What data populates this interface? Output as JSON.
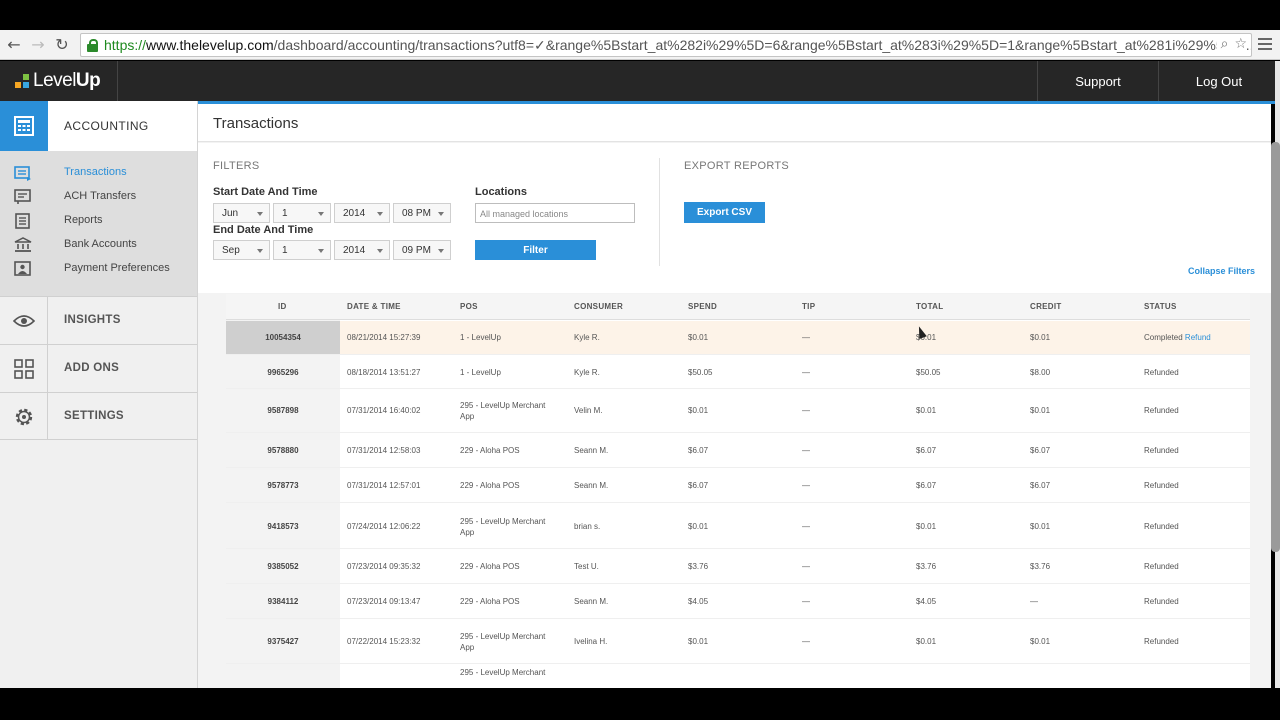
{
  "browser": {
    "url_scheme": "https://",
    "url_host": "www.thelevelup.com",
    "url_path": "/dashboard/accounting/transactions?utf8=✓&range%5Bstart_at%282i%29%5D=6&range%5Bstart_at%283i%29%5D=1&range%5Bstart_at%281i%29%5D=..."
  },
  "header": {
    "logo_level": "Level",
    "logo_up": "Up",
    "support": "Support",
    "logout": "Log Out"
  },
  "sidebar": {
    "accounting": "ACCOUNTING",
    "sub_items": [
      {
        "label": "Transactions",
        "icon": "transactions-icon",
        "active": true
      },
      {
        "label": "ACH Transfers",
        "icon": "ach-transfers-icon",
        "active": false
      },
      {
        "label": "Reports",
        "icon": "reports-icon",
        "active": false
      },
      {
        "label": "Bank Accounts",
        "icon": "bank-icon",
        "active": false
      },
      {
        "label": "Payment Preferences",
        "icon": "payment-preferences-icon",
        "active": false
      }
    ],
    "sections": [
      {
        "label": "INSIGHTS",
        "icon": "eye-icon"
      },
      {
        "label": "ADD ONS",
        "icon": "grid-icon"
      },
      {
        "label": "SETTINGS",
        "icon": "gear-icon"
      }
    ]
  },
  "page": {
    "title": "Transactions"
  },
  "filters": {
    "title": "FILTERS",
    "start_label": "Start Date And Time",
    "end_label": "End Date And Time",
    "start": {
      "month": "Jun",
      "day": "1",
      "year": "2014",
      "time": "08 PM"
    },
    "end": {
      "month": "Sep",
      "day": "1",
      "year": "2014",
      "time": "09 PM"
    },
    "locations_label": "Locations",
    "locations_placeholder": "All managed locations",
    "filter_button": "Filter",
    "export_title": "EXPORT REPORTS",
    "export_button": "Export CSV",
    "collapse": "Collapse Filters"
  },
  "table": {
    "headers": [
      "ID",
      "DATE & TIME",
      "POS",
      "CONSUMER",
      "SPEND",
      "TIP",
      "TOTAL",
      "CREDIT",
      "STATUS"
    ],
    "rows": [
      {
        "id": "10054354",
        "datetime": "08/21/2014 15:27:39",
        "pos": "1 - LevelUp",
        "consumer": "Kyle R.",
        "spend": "$0.01",
        "tip": "—",
        "total": "$0.01",
        "credit": "$0.01",
        "status": "Completed",
        "refund": "Refund"
      },
      {
        "id": "9965296",
        "datetime": "08/18/2014 13:51:27",
        "pos": "1 - LevelUp",
        "consumer": "Kyle R.",
        "spend": "$50.05",
        "tip": "—",
        "total": "$50.05",
        "credit": "$8.00",
        "status": "Refunded"
      },
      {
        "id": "9587898",
        "datetime": "07/31/2014 16:40:02",
        "pos": "295 - LevelUp Merchant App",
        "consumer": "Velin M.",
        "spend": "$0.01",
        "tip": "—",
        "total": "$0.01",
        "credit": "$0.01",
        "status": "Refunded"
      },
      {
        "id": "9578880",
        "datetime": "07/31/2014 12:58:03",
        "pos": "229 - Aloha POS",
        "consumer": "Seann M.",
        "spend": "$6.07",
        "tip": "—",
        "total": "$6.07",
        "credit": "$6.07",
        "status": "Refunded"
      },
      {
        "id": "9578773",
        "datetime": "07/31/2014 12:57:01",
        "pos": "229 - Aloha POS",
        "consumer": "Seann M.",
        "spend": "$6.07",
        "tip": "—",
        "total": "$6.07",
        "credit": "$6.07",
        "status": "Refunded"
      },
      {
        "id": "9418573",
        "datetime": "07/24/2014 12:06:22",
        "pos": "295 - LevelUp Merchant App",
        "consumer": "brian s.",
        "spend": "$0.01",
        "tip": "—",
        "total": "$0.01",
        "credit": "$0.01",
        "status": "Refunded"
      },
      {
        "id": "9385052",
        "datetime": "07/23/2014 09:35:32",
        "pos": "229 - Aloha POS",
        "consumer": "Test U.",
        "spend": "$3.76",
        "tip": "—",
        "total": "$3.76",
        "credit": "$3.76",
        "status": "Refunded"
      },
      {
        "id": "9384112",
        "datetime": "07/23/2014 09:13:47",
        "pos": "229 - Aloha POS",
        "consumer": "Seann M.",
        "spend": "$4.05",
        "tip": "—",
        "total": "$4.05",
        "credit": "—",
        "status": "Refunded"
      },
      {
        "id": "9375427",
        "datetime": "07/22/2014 15:23:32",
        "pos": "295 - LevelUp Merchant App",
        "consumer": "Ivelina H.",
        "spend": "$0.01",
        "tip": "—",
        "total": "$0.01",
        "credit": "$0.01",
        "status": "Refunded"
      },
      {
        "id": "",
        "datetime": "",
        "pos": "295 - LevelUp Merchant",
        "consumer": "",
        "spend": "",
        "tip": "",
        "total": "",
        "credit": "",
        "status": ""
      }
    ]
  },
  "colors": {
    "accent": "#2a8fd8",
    "header_bg": "#262626",
    "highlight_row": "#fdf3e8"
  }
}
